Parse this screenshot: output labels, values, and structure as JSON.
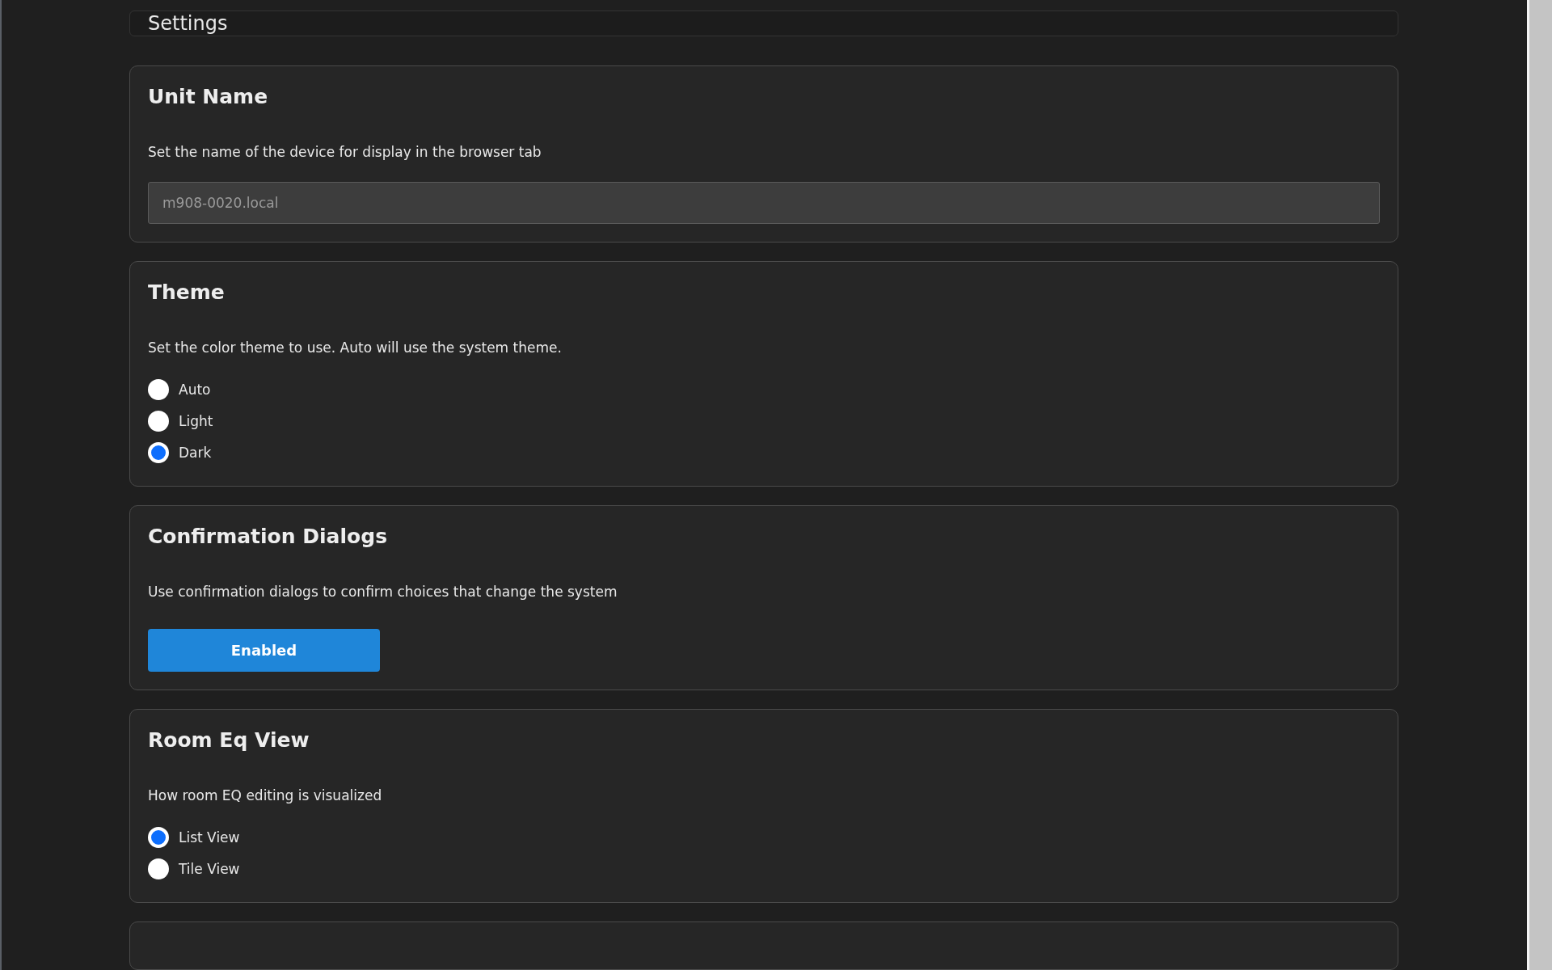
{
  "header": {
    "title": "Settings"
  },
  "sections": [
    {
      "kind": "text_input",
      "title": "Unit Name",
      "description": "Set the name of the device for display in the browser tab",
      "placeholder": "m908-0020.local"
    },
    {
      "kind": "radio",
      "title": "Theme",
      "description": "Set the color theme to use. Auto will use the system theme.",
      "options": [
        {
          "label": "Auto",
          "selected": false
        },
        {
          "label": "Light",
          "selected": false
        },
        {
          "label": "Dark",
          "selected": true
        }
      ]
    },
    {
      "kind": "toggle_button",
      "title": "Confirmation Dialogs",
      "description": "Use confirmation dialogs to confirm choices that change the system",
      "button": {
        "label": "Enabled",
        "on": true
      }
    },
    {
      "kind": "radio",
      "title": "Room Eq View",
      "description": "How room EQ editing is visualized",
      "options": [
        {
          "label": "List View",
          "selected": true
        },
        {
          "label": "Tile View",
          "selected": false
        }
      ]
    }
  ]
}
